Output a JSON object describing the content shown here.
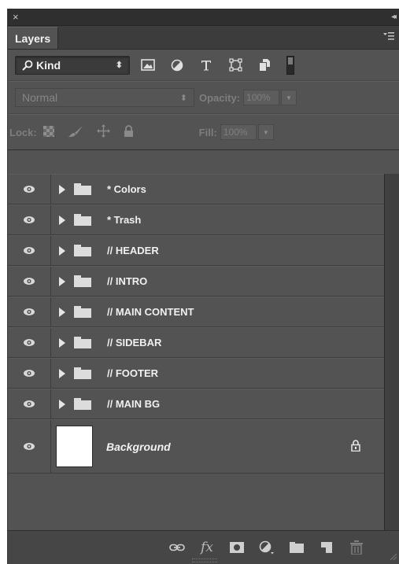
{
  "window": {
    "close_glyph": "×",
    "collapse_glyph": "◂◂"
  },
  "tabs": [
    {
      "label": "Layers",
      "active": true
    }
  ],
  "panel_menu_icon": "panel-menu-icon",
  "filter": {
    "kind_label": "Kind",
    "kind_arrows": "⬍",
    "icons": [
      "image-filter-icon",
      "adjustment-filter-icon",
      "type-filter-icon",
      "shape-filter-icon",
      "smart-object-filter-icon"
    ]
  },
  "blend": {
    "mode": "Normal",
    "arrows": "⬍",
    "opacity_label": "Opacity:",
    "opacity_value": "100%"
  },
  "lock": {
    "label": "Lock:",
    "icons": [
      "lock-transparent-pixels-icon",
      "lock-image-pixels-icon",
      "lock-position-icon",
      "lock-all-icon"
    ],
    "fill_label": "Fill:",
    "fill_value": "100%"
  },
  "layers": [
    {
      "name": "* Colors",
      "type": "group"
    },
    {
      "name": "* Trash",
      "type": "group"
    },
    {
      "name": "// HEADER",
      "type": "group"
    },
    {
      "name": "// INTRO",
      "type": "group"
    },
    {
      "name": "// MAIN CONTENT",
      "type": "group"
    },
    {
      "name": "// SIDEBAR",
      "type": "group"
    },
    {
      "name": "// FOOTER",
      "type": "group"
    },
    {
      "name": "// MAIN BG",
      "type": "group"
    }
  ],
  "background_layer": {
    "name": "Background",
    "locked": true
  },
  "bottom_toolbar": {
    "fx_label": "fx",
    "icons": [
      "link-layers-icon",
      "fx-icon",
      "add-mask-icon",
      "new-adjustment-icon",
      "new-group-icon",
      "new-layer-icon",
      "delete-layer-icon"
    ]
  },
  "colors": {
    "panel_bg": "#535353",
    "titlebar_bg": "#2f2f2f",
    "text": "#f0f0f0",
    "disabled_text": "#7e7e7e"
  }
}
